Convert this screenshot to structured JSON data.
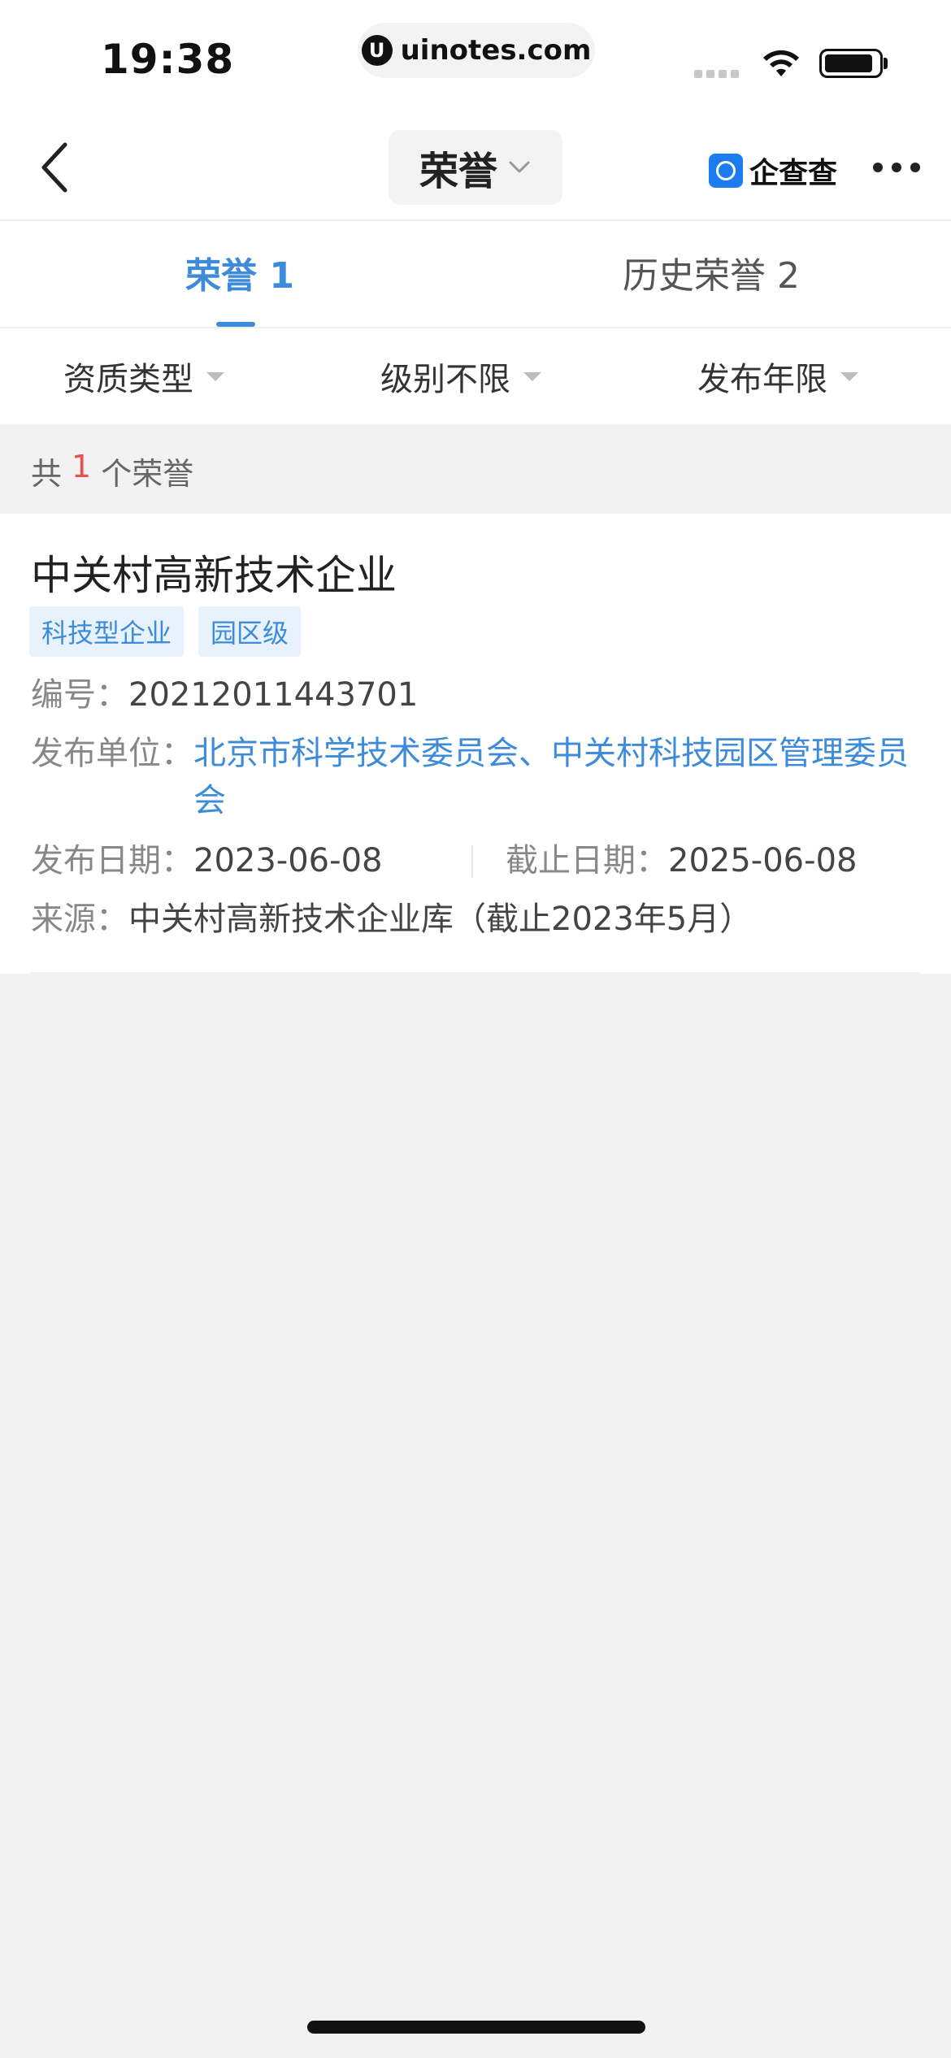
{
  "status_bar": {
    "time": "19:38",
    "url": "uinotes.com"
  },
  "nav": {
    "title": "荣誉",
    "brand": "企查查"
  },
  "tabs": [
    {
      "label": "荣誉 1",
      "active": true
    },
    {
      "label": "历史荣誉 2",
      "active": false
    }
  ],
  "filters": [
    "资质类型",
    "级别不限",
    "发布年限"
  ],
  "count": {
    "prefix": "共",
    "number": "1",
    "suffix": "个荣誉"
  },
  "card": {
    "title": "中关村高新技术企业",
    "tags": [
      "科技型企业",
      "园区级"
    ],
    "code_label": "编号：",
    "code": "20212011443701",
    "publisher_label": "发布单位：",
    "publisher": "北京市科学技术委员会、中关村科技园区管理委员会",
    "publish_date_label": "发布日期：",
    "publish_date": "2023-06-08",
    "deadline_label": "截止日期：",
    "deadline": "2025-06-08",
    "source_label": "来源：",
    "source": "中关村高新技术企业库（截止2023年5月）"
  },
  "colors": {
    "accent": "#3d8bd9",
    "count_highlight": "#e8524a",
    "tag_bg": "#e8f2fc",
    "page_bg": "#f2f2f2"
  }
}
